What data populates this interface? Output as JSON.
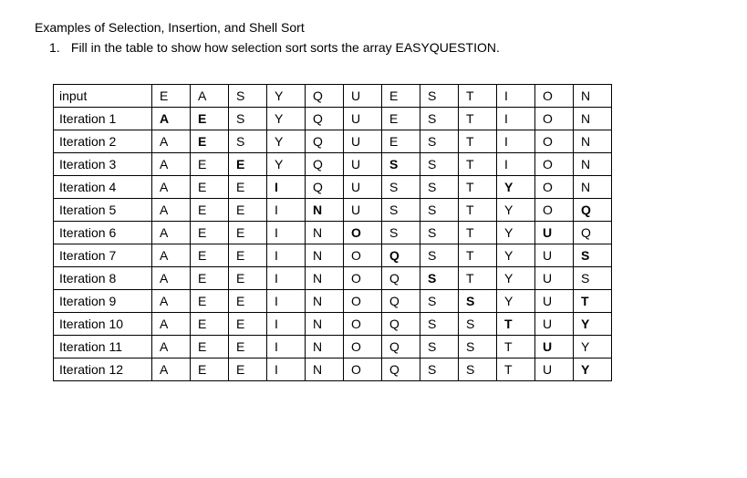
{
  "title": "Examples of Selection, Insertion, and Shell Sort",
  "instruction_number": "1.",
  "instruction_text": "Fill in the table to show how selection sort sorts the array EASYQUESTION.",
  "chart_data": {
    "type": "table",
    "title": "Selection sort trace for EASYQUESTION",
    "columns": 12,
    "rows": [
      {
        "label": "input",
        "cells": [
          {
            "v": "E",
            "b": false
          },
          {
            "v": "A",
            "b": false
          },
          {
            "v": "S",
            "b": false
          },
          {
            "v": "Y",
            "b": false
          },
          {
            "v": "Q",
            "b": false
          },
          {
            "v": "U",
            "b": false
          },
          {
            "v": "E",
            "b": false
          },
          {
            "v": "S",
            "b": false
          },
          {
            "v": "T",
            "b": false
          },
          {
            "v": "I",
            "b": false
          },
          {
            "v": "O",
            "b": false
          },
          {
            "v": "N",
            "b": false
          }
        ]
      },
      {
        "label": "Iteration 1",
        "cells": [
          {
            "v": "A",
            "b": true
          },
          {
            "v": "E",
            "b": true
          },
          {
            "v": "S",
            "b": false
          },
          {
            "v": "Y",
            "b": false
          },
          {
            "v": "Q",
            "b": false
          },
          {
            "v": "U",
            "b": false
          },
          {
            "v": "E",
            "b": false
          },
          {
            "v": "S",
            "b": false
          },
          {
            "v": "T",
            "b": false
          },
          {
            "v": "I",
            "b": false
          },
          {
            "v": "O",
            "b": false
          },
          {
            "v": "N",
            "b": false
          }
        ]
      },
      {
        "label": "Iteration 2",
        "cells": [
          {
            "v": "A",
            "b": false
          },
          {
            "v": "E",
            "b": true
          },
          {
            "v": "S",
            "b": false
          },
          {
            "v": "Y",
            "b": false
          },
          {
            "v": "Q",
            "b": false
          },
          {
            "v": "U",
            "b": false
          },
          {
            "v": "E",
            "b": false
          },
          {
            "v": "S",
            "b": false
          },
          {
            "v": "T",
            "b": false
          },
          {
            "v": "I",
            "b": false
          },
          {
            "v": "O",
            "b": false
          },
          {
            "v": "N",
            "b": false
          }
        ]
      },
      {
        "label": "Iteration 3",
        "cells": [
          {
            "v": "A",
            "b": false
          },
          {
            "v": "E",
            "b": false
          },
          {
            "v": "E",
            "b": true
          },
          {
            "v": "Y",
            "b": false
          },
          {
            "v": "Q",
            "b": false
          },
          {
            "v": "U",
            "b": false
          },
          {
            "v": "S",
            "b": true
          },
          {
            "v": "S",
            "b": false
          },
          {
            "v": "T",
            "b": false
          },
          {
            "v": "I",
            "b": false
          },
          {
            "v": "O",
            "b": false
          },
          {
            "v": "N",
            "b": false
          }
        ]
      },
      {
        "label": "Iteration 4",
        "cells": [
          {
            "v": "A",
            "b": false
          },
          {
            "v": "E",
            "b": false
          },
          {
            "v": "E",
            "b": false
          },
          {
            "v": "I",
            "b": true
          },
          {
            "v": "Q",
            "b": false
          },
          {
            "v": "U",
            "b": false
          },
          {
            "v": "S",
            "b": false
          },
          {
            "v": "S",
            "b": false
          },
          {
            "v": "T",
            "b": false
          },
          {
            "v": "Y",
            "b": true
          },
          {
            "v": "O",
            "b": false
          },
          {
            "v": "N",
            "b": false
          }
        ]
      },
      {
        "label": "Iteration 5",
        "cells": [
          {
            "v": "A",
            "b": false
          },
          {
            "v": "E",
            "b": false
          },
          {
            "v": "E",
            "b": false
          },
          {
            "v": "I",
            "b": false
          },
          {
            "v": "N",
            "b": true
          },
          {
            "v": "U",
            "b": false
          },
          {
            "v": "S",
            "b": false
          },
          {
            "v": "S",
            "b": false
          },
          {
            "v": "T",
            "b": false
          },
          {
            "v": "Y",
            "b": false
          },
          {
            "v": "O",
            "b": false
          },
          {
            "v": "Q",
            "b": true
          }
        ]
      },
      {
        "label": "Iteration 6",
        "cells": [
          {
            "v": "A",
            "b": false
          },
          {
            "v": "E",
            "b": false
          },
          {
            "v": "E",
            "b": false
          },
          {
            "v": "I",
            "b": false
          },
          {
            "v": "N",
            "b": false
          },
          {
            "v": "O",
            "b": true
          },
          {
            "v": "S",
            "b": false
          },
          {
            "v": "S",
            "b": false
          },
          {
            "v": "T",
            "b": false
          },
          {
            "v": "Y",
            "b": false
          },
          {
            "v": "U",
            "b": true
          },
          {
            "v": "Q",
            "b": false
          }
        ]
      },
      {
        "label": "Iteration 7",
        "cells": [
          {
            "v": "A",
            "b": false
          },
          {
            "v": "E",
            "b": false
          },
          {
            "v": "E",
            "b": false
          },
          {
            "v": "I",
            "b": false
          },
          {
            "v": "N",
            "b": false
          },
          {
            "v": "O",
            "b": false
          },
          {
            "v": "Q",
            "b": true
          },
          {
            "v": "S",
            "b": false
          },
          {
            "v": "T",
            "b": false
          },
          {
            "v": "Y",
            "b": false
          },
          {
            "v": "U",
            "b": false
          },
          {
            "v": "S",
            "b": true
          }
        ]
      },
      {
        "label": "Iteration 8",
        "cells": [
          {
            "v": "A",
            "b": false
          },
          {
            "v": "E",
            "b": false
          },
          {
            "v": "E",
            "b": false
          },
          {
            "v": "I",
            "b": false
          },
          {
            "v": "N",
            "b": false
          },
          {
            "v": "O",
            "b": false
          },
          {
            "v": "Q",
            "b": false
          },
          {
            "v": "S",
            "b": true
          },
          {
            "v": "T",
            "b": false
          },
          {
            "v": "Y",
            "b": false
          },
          {
            "v": "U",
            "b": false
          },
          {
            "v": "S",
            "b": false
          }
        ]
      },
      {
        "label": "Iteration 9",
        "cells": [
          {
            "v": "A",
            "b": false
          },
          {
            "v": "E",
            "b": false
          },
          {
            "v": "E",
            "b": false
          },
          {
            "v": "I",
            "b": false
          },
          {
            "v": "N",
            "b": false
          },
          {
            "v": "O",
            "b": false
          },
          {
            "v": "Q",
            "b": false
          },
          {
            "v": "S",
            "b": false
          },
          {
            "v": "S",
            "b": true
          },
          {
            "v": "Y",
            "b": false
          },
          {
            "v": "U",
            "b": false
          },
          {
            "v": "T",
            "b": true
          }
        ]
      },
      {
        "label": "Iteration 10",
        "cells": [
          {
            "v": "A",
            "b": false
          },
          {
            "v": "E",
            "b": false
          },
          {
            "v": "E",
            "b": false
          },
          {
            "v": "I",
            "b": false
          },
          {
            "v": "N",
            "b": false
          },
          {
            "v": "O",
            "b": false
          },
          {
            "v": "Q",
            "b": false
          },
          {
            "v": "S",
            "b": false
          },
          {
            "v": "S",
            "b": false
          },
          {
            "v": "T",
            "b": true
          },
          {
            "v": "U",
            "b": false
          },
          {
            "v": "Y",
            "b": true
          }
        ]
      },
      {
        "label": "Iteration 11",
        "cells": [
          {
            "v": "A",
            "b": false
          },
          {
            "v": "E",
            "b": false
          },
          {
            "v": "E",
            "b": false
          },
          {
            "v": "I",
            "b": false
          },
          {
            "v": "N",
            "b": false
          },
          {
            "v": "O",
            "b": false
          },
          {
            "v": "Q",
            "b": false
          },
          {
            "v": "S",
            "b": false
          },
          {
            "v": "S",
            "b": false
          },
          {
            "v": "T",
            "b": false
          },
          {
            "v": "U",
            "b": true
          },
          {
            "v": "Y",
            "b": false
          }
        ]
      },
      {
        "label": "Iteration 12",
        "cells": [
          {
            "v": "A",
            "b": false
          },
          {
            "v": "E",
            "b": false
          },
          {
            "v": "E",
            "b": false
          },
          {
            "v": "I",
            "b": false
          },
          {
            "v": "N",
            "b": false
          },
          {
            "v": "O",
            "b": false
          },
          {
            "v": "Q",
            "b": false
          },
          {
            "v": "S",
            "b": false
          },
          {
            "v": "S",
            "b": false
          },
          {
            "v": "T",
            "b": false
          },
          {
            "v": "U",
            "b": false
          },
          {
            "v": "Y",
            "b": true
          }
        ]
      }
    ]
  }
}
